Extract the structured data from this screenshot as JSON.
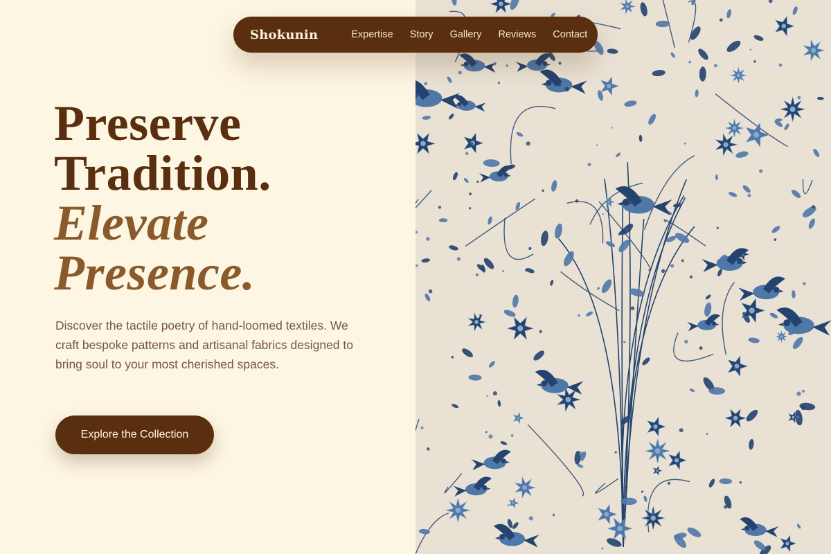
{
  "nav": {
    "brand": "Shokunin",
    "links": [
      "Expertise",
      "Story",
      "Gallery",
      "Reviews",
      "Contact"
    ]
  },
  "hero": {
    "title_lines": [
      "Preserve",
      "Tradition.",
      "Elevate",
      "Presence."
    ],
    "description": "Discover the tactile poetry of hand-loomed textiles. We craft bespoke patterns and artisanal fabrics designed to bring soul to your most cherished spaces.",
    "cta_label": "Explore the Collection"
  },
  "image": {
    "subject": "indigo-floral-bird-textile",
    "background_color": "#e9e2d4",
    "pattern_colors": [
      "#24436e",
      "#4f78a8",
      "#89a9cb"
    ]
  },
  "colors": {
    "page_background": "#fdf6e3",
    "primary_brown": "#5a2f0f",
    "accent_brown": "#8a5a2b",
    "body_text": "#75573f",
    "nav_text": "#f4e6cc"
  }
}
